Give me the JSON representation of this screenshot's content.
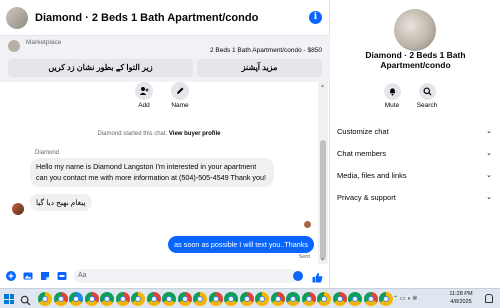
{
  "chat": {
    "title": "Diamond · 2 Beds 1 Bath Apartment/condo",
    "marketplace_label": "Marketplace",
    "listing": "2 Beds 1 Bath Apartment/condo - $850",
    "mark_button": "زیر التوا کے بطور نشان زد کریں",
    "more_button": "مزید آپشنز",
    "actions": [
      {
        "label": "Add",
        "icon": "add-person-icon"
      },
      {
        "label": "Name",
        "icon": "pencil-icon"
      }
    ],
    "started_text": "Diamond started this chat.",
    "view_profile": "View buyer profile",
    "sender": "Diamond",
    "incoming_message": "Hello my name is Diamond Langston I'm interested in your apartment can you contact me with more information at (504)-505-4549 Thank you!",
    "system_message": "پیغام بھیج دیا گیا",
    "outgoing_message": "as soon as possible I will text you..Thanks",
    "sent_status": "Sent",
    "composer_placeholder": "Aa",
    "accent": "#0866ff"
  },
  "info": {
    "name": "Diamond · 2 Beds 1 Bath Apartment/condo",
    "actions": [
      {
        "label": "Mute",
        "icon": "bell-icon"
      },
      {
        "label": "Search",
        "icon": "search-icon"
      }
    ],
    "sections": [
      "Customize chat",
      "Chat members",
      "Media, files and links",
      "Privacy & support"
    ]
  },
  "taskbar": {
    "time": "11:28 PM",
    "date": "4/8/2025",
    "apps": [
      {
        "icon": "file-explorer-icon",
        "color": "#f4b400"
      },
      {
        "icon": "chrome-icon",
        "color": "#db4437"
      },
      {
        "icon": "edge-icon",
        "color": "#1e88e5"
      },
      {
        "icon": "chrome-icon",
        "color": "#db4437"
      },
      {
        "icon": "chrome-icon",
        "color": "#0f9d58"
      },
      {
        "icon": "chrome-icon",
        "color": "#db4437"
      },
      {
        "icon": "chrome-icon",
        "color": "#f4b400"
      },
      {
        "icon": "chrome-icon",
        "color": "#db4437"
      },
      {
        "icon": "chrome-icon",
        "color": "#0f9d58"
      },
      {
        "icon": "chrome-icon",
        "color": "#db4437"
      },
      {
        "icon": "chrome-icon",
        "color": "#f4b400"
      },
      {
        "icon": "chrome-icon",
        "color": "#db4437"
      },
      {
        "icon": "chrome-icon",
        "color": "#0f9d58"
      },
      {
        "icon": "chrome-icon",
        "color": "#db4437"
      },
      {
        "icon": "chrome-icon",
        "color": "#f4b400"
      },
      {
        "icon": "chrome-icon",
        "color": "#db4437"
      },
      {
        "icon": "chrome-icon",
        "color": "#0f9d58"
      },
      {
        "icon": "chrome-icon",
        "color": "#db4437"
      },
      {
        "icon": "chrome-icon",
        "color": "#f4b400"
      },
      {
        "icon": "chrome-icon",
        "color": "#db4437"
      },
      {
        "icon": "chrome-icon",
        "color": "#0f9d58"
      },
      {
        "icon": "chrome-icon",
        "color": "#db4437"
      },
      {
        "icon": "chrome-icon",
        "color": "#f4b400"
      }
    ]
  }
}
